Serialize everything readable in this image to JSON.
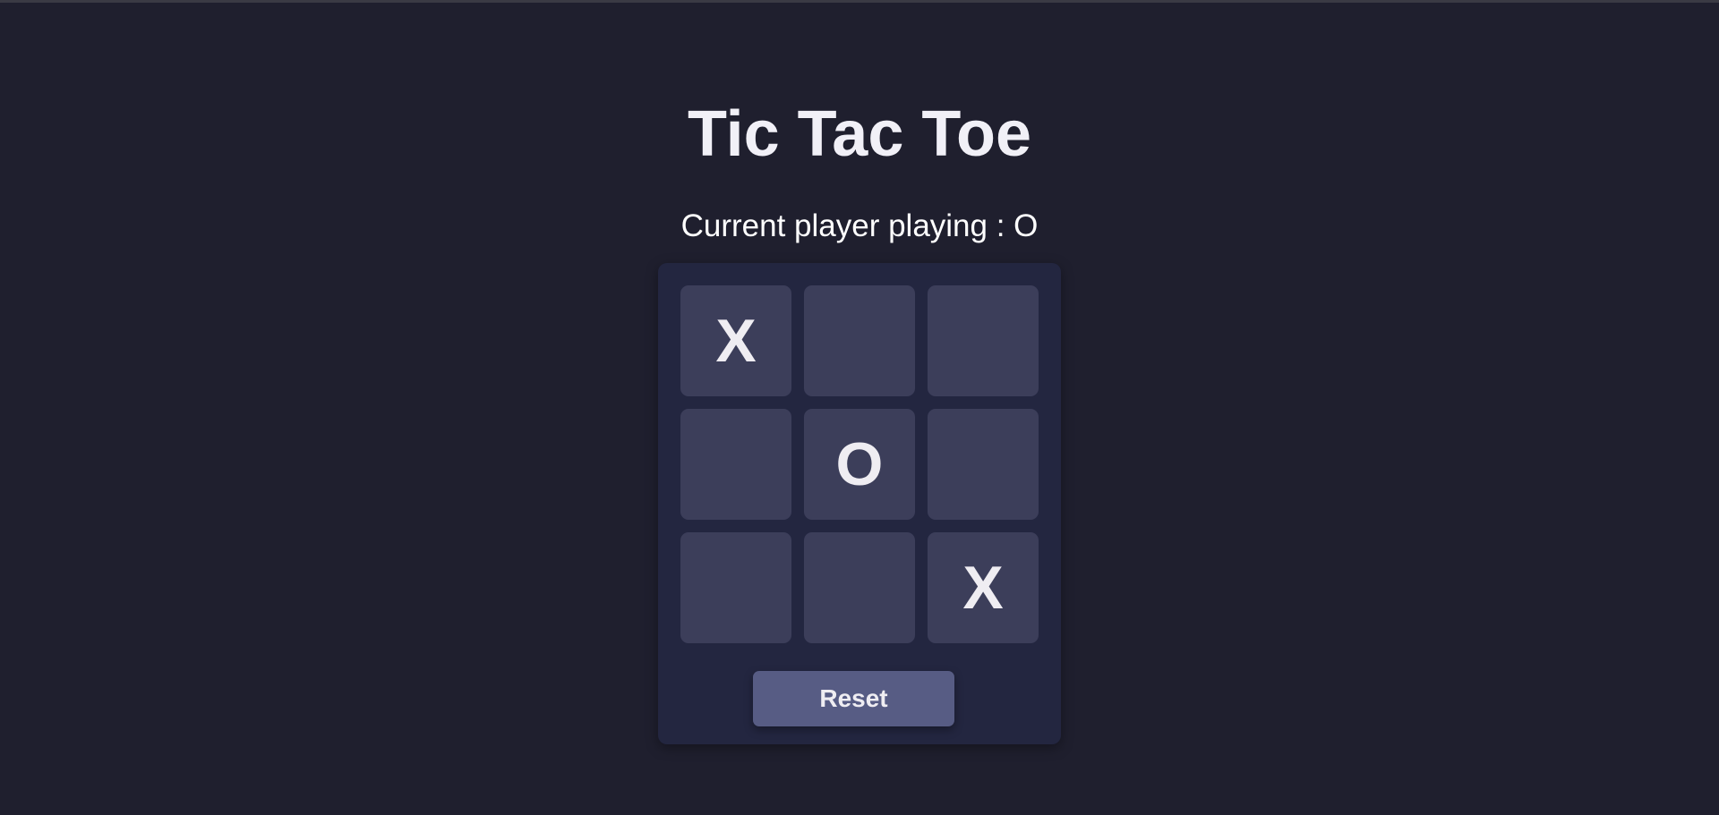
{
  "title": "Tic Tac Toe",
  "status": "Current player playing : O",
  "board": {
    "cells": [
      "X",
      "",
      "",
      "",
      "O",
      "",
      "",
      "",
      "X"
    ]
  },
  "reset_label": "Reset",
  "colors": {
    "background": "#1f1f2e",
    "card": "#232640",
    "cell": "#3c3e5a",
    "button": "#575c84",
    "text": "#efedf2"
  }
}
